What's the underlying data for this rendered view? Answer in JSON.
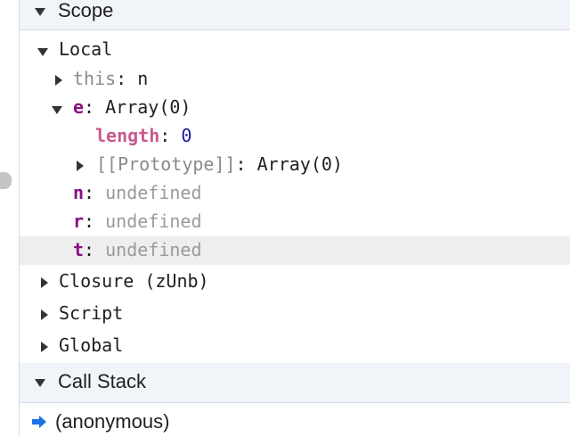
{
  "sections": {
    "scope": {
      "label": "Scope",
      "expanded": true
    },
    "call_stack": {
      "label": "Call Stack",
      "expanded": true
    }
  },
  "scope_tree": {
    "local": {
      "label": "Local",
      "expanded": true,
      "this": {
        "name": "this",
        "value": "n"
      },
      "e": {
        "name": "e",
        "value": "Array(0)",
        "expanded": true,
        "length": {
          "name": "length",
          "value": "0"
        },
        "prototype": {
          "name": "[[Prototype]]",
          "value": "Array(0)"
        }
      },
      "n": {
        "name": "n",
        "value": "undefined"
      },
      "r": {
        "name": "r",
        "value": "undefined"
      },
      "t": {
        "name": "t",
        "value": "undefined"
      }
    },
    "closure": {
      "label": "Closure (zUnb)"
    },
    "script": {
      "label": "Script"
    },
    "global": {
      "label": "Global"
    }
  },
  "call_stack": {
    "frames": [
      {
        "label": "(anonymous)",
        "current": true
      }
    ]
  },
  "colors": {
    "header_bg": "#f1f4f9",
    "property_key": "#881280",
    "number": "#1a1aa6",
    "current_frame_arrow": "#1a73e8",
    "highlight_row": "#eeeeee"
  },
  "icons": {
    "expanded": "triangle-down-icon",
    "collapsed": "triangle-right-icon",
    "current_frame": "current-frame-arrow-icon"
  }
}
